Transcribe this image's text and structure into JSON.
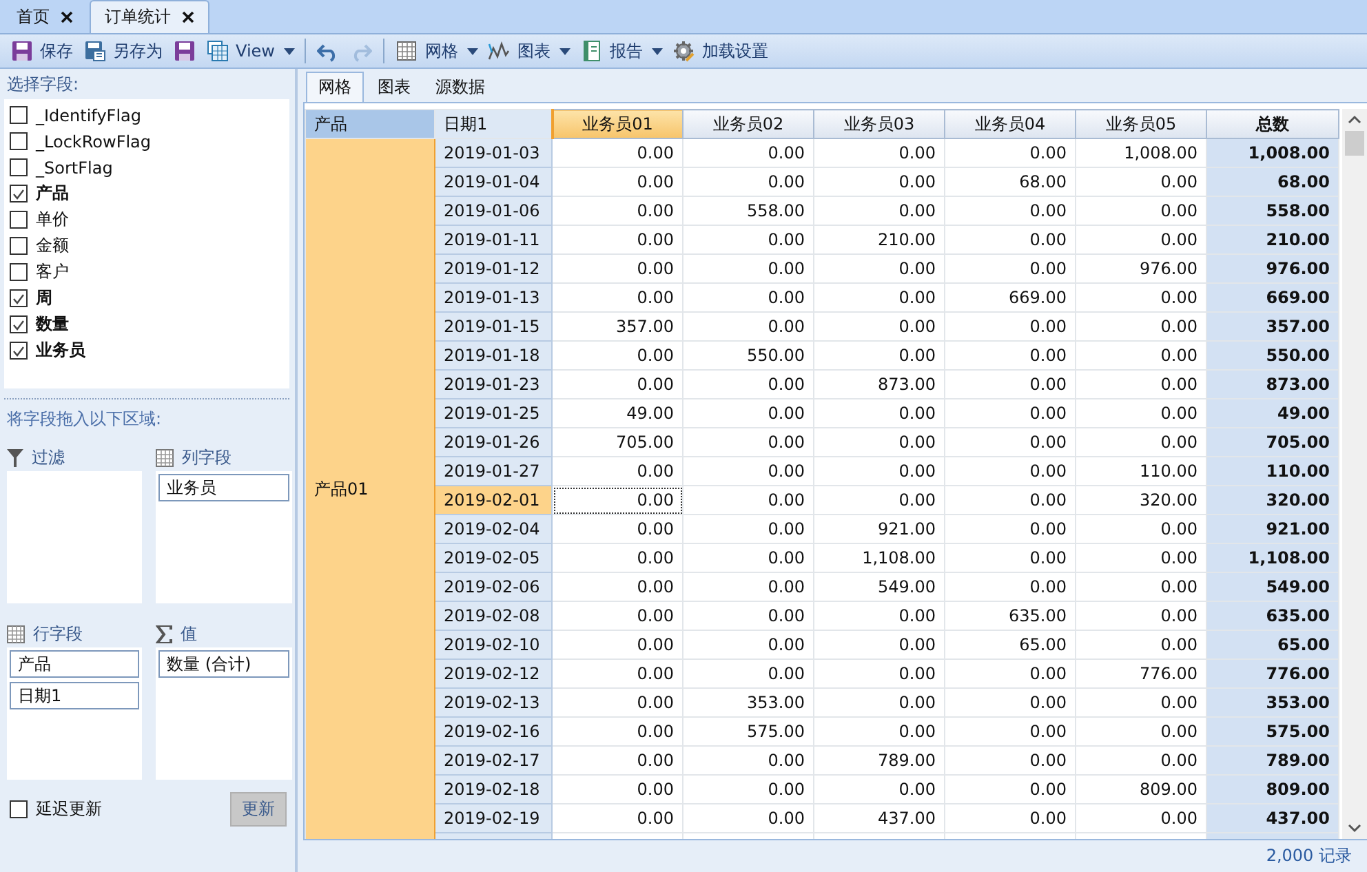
{
  "doc_tabs": [
    {
      "label": "首页",
      "selected": false
    },
    {
      "label": "订单统计",
      "selected": true
    }
  ],
  "toolbar": [
    {
      "kind": "save",
      "label": "保存"
    },
    {
      "kind": "save-as",
      "label": "另存为"
    },
    {
      "kind": "save-plain"
    },
    {
      "kind": "view",
      "label": "View",
      "dropdown": true
    },
    {
      "kind": "separator"
    },
    {
      "kind": "undo",
      "disabled": false
    },
    {
      "kind": "redo",
      "disabled": true
    },
    {
      "kind": "separator"
    },
    {
      "kind": "grid",
      "label": "网格",
      "dropdown": true
    },
    {
      "kind": "chart",
      "label": "图表",
      "dropdown": true
    },
    {
      "kind": "report",
      "label": "报告",
      "dropdown": true
    },
    {
      "kind": "gear",
      "label": "加载设置"
    }
  ],
  "field_panel": {
    "title": "选择字段:",
    "fields": [
      {
        "label": "_IdentifyFlag",
        "checked": false
      },
      {
        "label": "_LockRowFlag",
        "checked": false
      },
      {
        "label": "_SortFlag",
        "checked": false
      },
      {
        "label": "产品",
        "checked": true
      },
      {
        "label": "单价",
        "checked": false
      },
      {
        "label": "金额",
        "checked": false
      },
      {
        "label": "客户",
        "checked": false
      },
      {
        "label": "周",
        "checked": true
      },
      {
        "label": "数量",
        "checked": true
      },
      {
        "label": "业务员",
        "checked": true
      }
    ],
    "drop_hint": "将字段拖入以下区域:",
    "areas": [
      {
        "kind": "filter",
        "title": "过滤"
      },
      {
        "kind": "columns",
        "title": "列字段",
        "items": [
          "业务员"
        ]
      },
      {
        "kind": "rows",
        "title": "行字段",
        "items": [
          "产品",
          "日期1"
        ]
      },
      {
        "kind": "values",
        "title": "值",
        "items": [
          "数量 (合计)"
        ]
      }
    ],
    "defer_update": {
      "label": "延迟更新",
      "checked": false
    },
    "update_button": "更新"
  },
  "view_tabs": [
    {
      "label": "网格",
      "selected": true
    },
    {
      "label": "图表",
      "selected": false
    },
    {
      "label": "源数据",
      "selected": false
    }
  ],
  "grid": {
    "row_headers": [
      "产品",
      "日期1"
    ],
    "columns": [
      {
        "label": "业务员01",
        "selected": true
      },
      {
        "label": "业务员02",
        "selected": false
      },
      {
        "label": "业务员03",
        "selected": false
      },
      {
        "label": "业务员04",
        "selected": false
      },
      {
        "label": "业务员05",
        "selected": false
      }
    ],
    "total_header": "总数",
    "product": "产品01",
    "rows": [
      {
        "date": "2019-01-03",
        "values": [
          "0.00",
          "0.00",
          "0.00",
          "0.00",
          "1,008.00"
        ],
        "total": "1,008.00",
        "selected": false
      },
      {
        "date": "2019-01-04",
        "values": [
          "0.00",
          "0.00",
          "0.00",
          "68.00",
          "0.00"
        ],
        "total": "68.00",
        "selected": false
      },
      {
        "date": "2019-01-06",
        "values": [
          "0.00",
          "558.00",
          "0.00",
          "0.00",
          "0.00"
        ],
        "total": "558.00",
        "selected": false
      },
      {
        "date": "2019-01-11",
        "values": [
          "0.00",
          "0.00",
          "210.00",
          "0.00",
          "0.00"
        ],
        "total": "210.00",
        "selected": false
      },
      {
        "date": "2019-01-12",
        "values": [
          "0.00",
          "0.00",
          "0.00",
          "0.00",
          "976.00"
        ],
        "total": "976.00",
        "selected": false
      },
      {
        "date": "2019-01-13",
        "values": [
          "0.00",
          "0.00",
          "0.00",
          "669.00",
          "0.00"
        ],
        "total": "669.00",
        "selected": false
      },
      {
        "date": "2019-01-15",
        "values": [
          "357.00",
          "0.00",
          "0.00",
          "0.00",
          "0.00"
        ],
        "total": "357.00",
        "selected": false
      },
      {
        "date": "2019-01-18",
        "values": [
          "0.00",
          "550.00",
          "0.00",
          "0.00",
          "0.00"
        ],
        "total": "550.00",
        "selected": false
      },
      {
        "date": "2019-01-23",
        "values": [
          "0.00",
          "0.00",
          "873.00",
          "0.00",
          "0.00"
        ],
        "total": "873.00",
        "selected": false
      },
      {
        "date": "2019-01-25",
        "values": [
          "49.00",
          "0.00",
          "0.00",
          "0.00",
          "0.00"
        ],
        "total": "49.00",
        "selected": false
      },
      {
        "date": "2019-01-26",
        "values": [
          "705.00",
          "0.00",
          "0.00",
          "0.00",
          "0.00"
        ],
        "total": "705.00",
        "selected": false
      },
      {
        "date": "2019-01-27",
        "values": [
          "0.00",
          "0.00",
          "0.00",
          "0.00",
          "110.00"
        ],
        "total": "110.00",
        "selected": false
      },
      {
        "date": "2019-02-01",
        "values": [
          "0.00",
          "0.00",
          "0.00",
          "0.00",
          "320.00"
        ],
        "total": "320.00",
        "selected": true
      },
      {
        "date": "2019-02-04",
        "values": [
          "0.00",
          "0.00",
          "921.00",
          "0.00",
          "0.00"
        ],
        "total": "921.00",
        "selected": false
      },
      {
        "date": "2019-02-05",
        "values": [
          "0.00",
          "0.00",
          "1,108.00",
          "0.00",
          "0.00"
        ],
        "total": "1,108.00",
        "selected": false
      },
      {
        "date": "2019-02-06",
        "values": [
          "0.00",
          "0.00",
          "549.00",
          "0.00",
          "0.00"
        ],
        "total": "549.00",
        "selected": false
      },
      {
        "date": "2019-02-08",
        "values": [
          "0.00",
          "0.00",
          "0.00",
          "635.00",
          "0.00"
        ],
        "total": "635.00",
        "selected": false
      },
      {
        "date": "2019-02-10",
        "values": [
          "0.00",
          "0.00",
          "0.00",
          "65.00",
          "0.00"
        ],
        "total": "65.00",
        "selected": false
      },
      {
        "date": "2019-02-12",
        "values": [
          "0.00",
          "0.00",
          "0.00",
          "0.00",
          "776.00"
        ],
        "total": "776.00",
        "selected": false
      },
      {
        "date": "2019-02-13",
        "values": [
          "0.00",
          "353.00",
          "0.00",
          "0.00",
          "0.00"
        ],
        "total": "353.00",
        "selected": false
      },
      {
        "date": "2019-02-16",
        "values": [
          "0.00",
          "575.00",
          "0.00",
          "0.00",
          "0.00"
        ],
        "total": "575.00",
        "selected": false
      },
      {
        "date": "2019-02-17",
        "values": [
          "0.00",
          "0.00",
          "789.00",
          "0.00",
          "0.00"
        ],
        "total": "789.00",
        "selected": false
      },
      {
        "date": "2019-02-18",
        "values": [
          "0.00",
          "0.00",
          "0.00",
          "0.00",
          "809.00"
        ],
        "total": "809.00",
        "selected": false
      },
      {
        "date": "2019-02-19",
        "values": [
          "0.00",
          "0.00",
          "437.00",
          "0.00",
          "0.00"
        ],
        "total": "437.00",
        "selected": false
      }
    ]
  },
  "status_bar": {
    "record_count": "2,000 记录"
  }
}
